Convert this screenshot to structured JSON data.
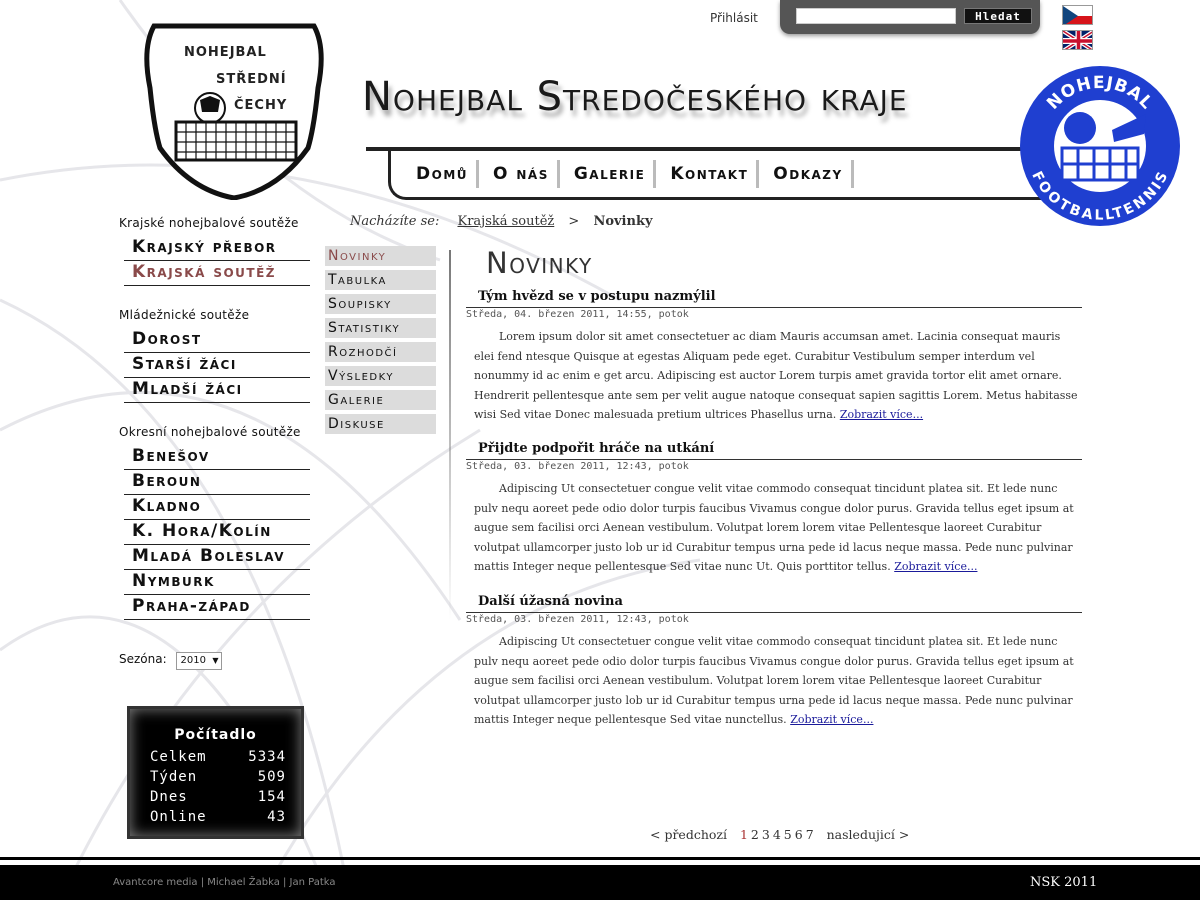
{
  "header": {
    "logo_left_lines": [
      "NOHEJBAL",
      "STŘEDNÍ",
      "ČECHY"
    ],
    "title": "Nohejbal Stredočeského kraje",
    "login_label": "Přihlásit",
    "search_value": "",
    "search_button": "Hledat"
  },
  "nav": {
    "items": [
      "Domů",
      "O nás",
      "Galerie",
      "Kontakt",
      "Odkazy"
    ]
  },
  "logo_right": {
    "top_text": "NOHEJBAL",
    "bottom_text": "FOOTBALLTENNIS",
    "color": "#1f3fd0"
  },
  "breadcrumb": {
    "prefix": "Nacházíte se:",
    "link": "Krajská soutěž",
    "separator": ">",
    "current": "Novinky"
  },
  "sidebar": {
    "sections": [
      {
        "title": "Krajské nohejbalové soutěže",
        "items": [
          "Krajský přebor",
          "Krajská soutěž"
        ],
        "active_index": 1
      },
      {
        "title": "Mládežnické soutěže",
        "items": [
          "Dorost",
          "Starší žáci",
          "Mladší žáci"
        ]
      },
      {
        "title": "Okresní nohejbalové soutěže",
        "items": [
          "Benešov",
          "Beroun",
          "Kladno",
          "K. Hora/Kolín",
          "Mladá Boleslav",
          "Nymburk",
          "Praha-západ"
        ]
      }
    ],
    "season_label": "Sezóna:",
    "season_value": "2010"
  },
  "counter": {
    "title": "Počítadlo",
    "rows": [
      {
        "label": "Celkem",
        "value": "5334"
      },
      {
        "label": "Týden",
        "value": "509"
      },
      {
        "label": "Dnes",
        "value": "154"
      },
      {
        "label": "Online",
        "value": "43"
      }
    ]
  },
  "submenu": {
    "items": [
      "Novinky",
      "Tabulka",
      "Soupisky",
      "Statistiky",
      "Rozhodčí",
      "Výsledky",
      "Galerie",
      "Diskuse"
    ],
    "active_index": 0
  },
  "content": {
    "heading": "Novinky",
    "articles": [
      {
        "title": "Tým hvězd se v postupu nazmýlil",
        "date": "Středa, 04. březen 2011, 14:55, potok",
        "body": "Lorem ipsum dolor sit amet consectetuer ac diam Mauris accumsan amet. Lacinia consequat mauris elei fend ntesque Quisque at egestas Aliquam pede eget. Curabitur Vestibulum semper interdum vel nonummy id ac enim e get arcu. Adipiscing est auctor Lorem turpis amet gravida tortor elit amet ornare. Hendrerit pellentesque ante sem per velit augue natoque consequat sapien sagittis Lorem. Metus habitasse wisi Sed vitae Donec malesuada pretium ultrices Phasellus urna.",
        "more": "Zobrazit více..."
      },
      {
        "title": "Přijdte podpořit hráče na utkání",
        "date": "Středa, 03. březen 2011, 12:43, potok",
        "body": "Adipiscing Ut consectetuer congue velit vitae commodo consequat tincidunt platea sit. Et lede nunc pulv nequ aoreet pede odio dolor turpis faucibus Vivamus congue dolor purus. Gravida tellus eget ipsum at augue sem facilisi orci Aenean vestibulum. Volutpat lorem lorem vitae Pellentesque laoreet Curabitur volutpat ullamcorper justo lob ur id Curabitur tempus urna pede id lacus neque massa. Pede nunc pulvinar mattis Integer neque pellentesque Sed vitae nunc Ut. Quis porttitor tellus.",
        "more": "Zobrazit více..."
      },
      {
        "title": "Další úžasná novina",
        "date": "Středa, 03. březen 2011, 12:43, potok",
        "body": "Adipiscing Ut consectetuer congue velit vitae commodo consequat tincidunt platea sit. Et lede nunc pulv nequ aoreet pede odio dolor turpis faucibus Vivamus congue dolor purus. Gravida tellus eget ipsum at augue sem facilisi orci Aenean vestibulum. Volutpat lorem lorem vitae Pellentesque laoreet Curabitur volutpat ullamcorper justo lob ur id Curabitur tempus urna pede id lacus neque massa. Pede nunc pulvinar mattis Integer neque pellentesque Sed vitae nunctellus.",
        "more": "Zobrazit více..."
      }
    ]
  },
  "pagination": {
    "prev": "< předchozí",
    "pages": [
      "1",
      "2",
      "3",
      "4",
      "5",
      "6",
      "7"
    ],
    "current": "1",
    "next": "nasledujicí >"
  },
  "footer": {
    "credits": "Avantcore media | Michael Žabka | Jan Patka",
    "copyright": "NSK 2011"
  }
}
